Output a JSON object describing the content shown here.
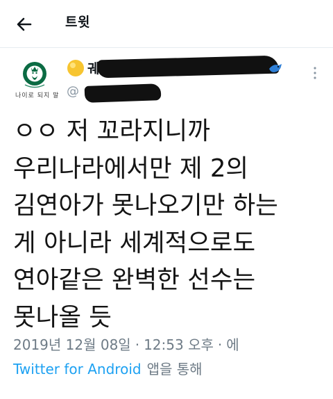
{
  "header": {
    "back_icon": "arrow-left-icon",
    "title": "트윗"
  },
  "author": {
    "avatar_icon": "starbucks-logo-icon",
    "avatar_caption": "나이로 되지 말",
    "name_visible": "궤도",
    "handle_visible": "@",
    "emoji": "yellow-circle-emoji",
    "badge_icon": "blue-bird-icon",
    "more_icon": "more-vertical-icon"
  },
  "tweet": {
    "lines": [
      "ㅇㅇ 저 꼬라지니까",
      "우리나라에서만 제 2의",
      "김연아가 못나오기만 하는",
      "게 아니라 세계적으로도",
      "연아같은 완벽한 선수는",
      "못나올 듯"
    ]
  },
  "meta": {
    "date": "2019년 12월 08일",
    "time": "12:53 오후",
    "suffix": "에",
    "app": "Twitter for Android",
    "via": "앱을 통해"
  },
  "colors": {
    "accent": "#1da1f2",
    "muted": "#6e7b86",
    "text": "#141414"
  }
}
